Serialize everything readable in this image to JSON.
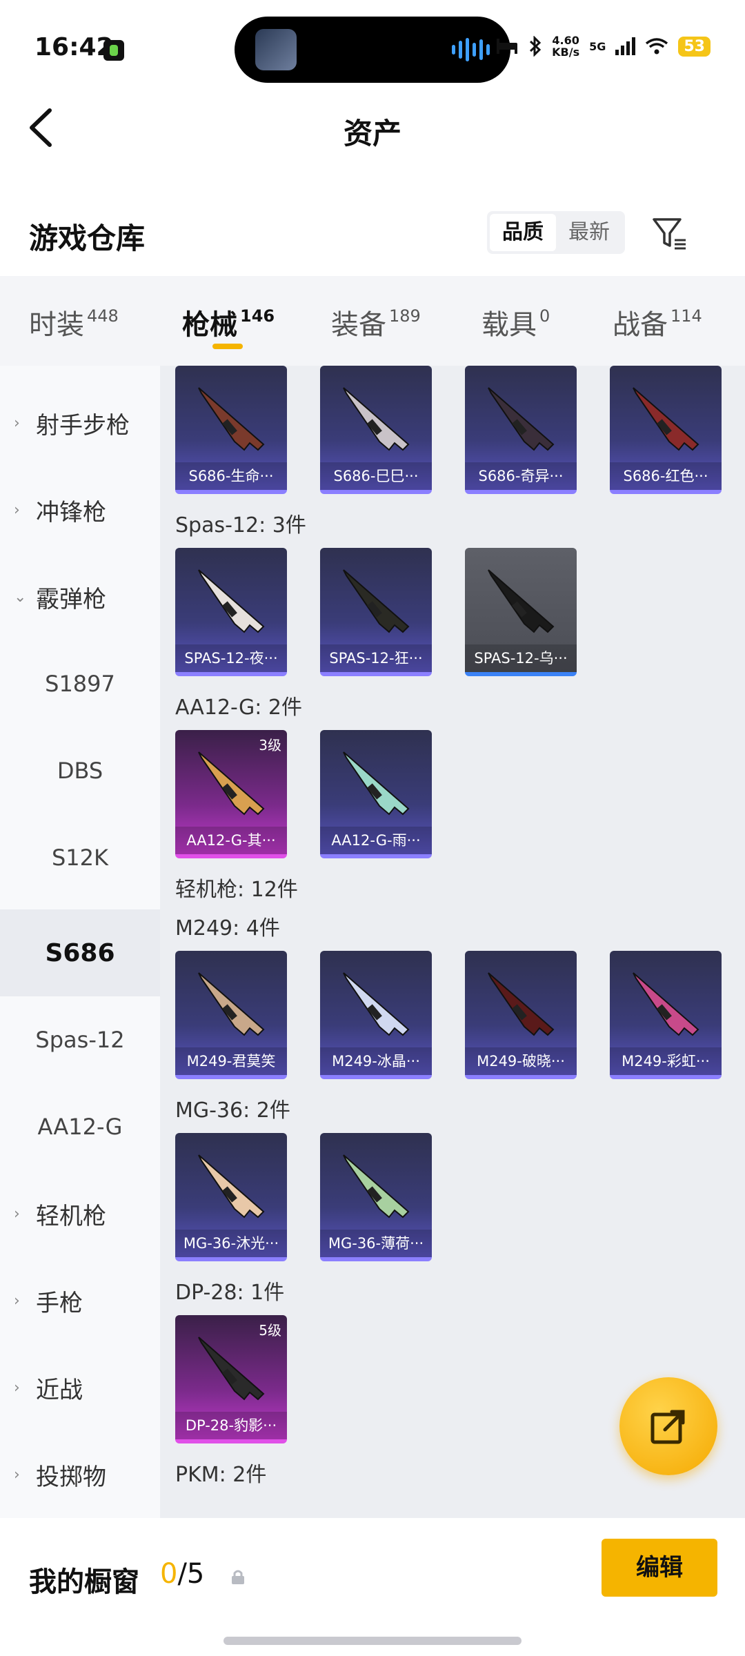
{
  "status_bar": {
    "time": "16:42",
    "net_speed_value": "4.60",
    "net_speed_unit": "KB/s",
    "network": "5G",
    "battery": "53"
  },
  "header": {
    "title": "资产",
    "back_icon": "chevron-left-icon"
  },
  "warehouse": {
    "title": "游戏仓库",
    "sort_options": [
      "品质",
      "最新"
    ],
    "sort_selected": "品质",
    "filter_icon": "filter-icon"
  },
  "tabs": [
    {
      "label": "时装",
      "count": "448"
    },
    {
      "label": "枪械",
      "count": "146",
      "active": true
    },
    {
      "label": "装备",
      "count": "189"
    },
    {
      "label": "载具",
      "count": "0"
    },
    {
      "label": "战备",
      "count": "114"
    }
  ],
  "sidebar": {
    "items": [
      {
        "label": "射手步枪",
        "type": "category",
        "expanded": false
      },
      {
        "label": "冲锋枪",
        "type": "category",
        "expanded": false
      },
      {
        "label": "霰弹枪",
        "type": "category",
        "expanded": true
      },
      {
        "label": "S1897",
        "type": "sub"
      },
      {
        "label": "DBS",
        "type": "sub"
      },
      {
        "label": "S12K",
        "type": "sub"
      },
      {
        "label": "S686",
        "type": "sub",
        "selected": true
      },
      {
        "label": "Spas-12",
        "type": "sub"
      },
      {
        "label": "AA12-G",
        "type": "sub"
      },
      {
        "label": "轻机枪",
        "type": "category",
        "expanded": false
      },
      {
        "label": "手枪",
        "type": "category",
        "expanded": false
      },
      {
        "label": "近战",
        "type": "category",
        "expanded": false
      },
      {
        "label": "投掷物",
        "type": "category",
        "expanded": false
      }
    ]
  },
  "groups": [
    {
      "label": "",
      "items": [
        {
          "name": "S686-生命···",
          "rarity": "purple"
        },
        {
          "name": "S686-巳巳···",
          "rarity": "purple"
        },
        {
          "name": "S686-奇异···",
          "rarity": "purple"
        },
        {
          "name": "S686-红色···",
          "rarity": "purple"
        }
      ]
    },
    {
      "label": "Spas-12: 3件",
      "items": [
        {
          "name": "SPAS-12-夜···",
          "rarity": "purple"
        },
        {
          "name": "SPAS-12-狂···",
          "rarity": "purple"
        },
        {
          "name": "SPAS-12-乌···",
          "rarity": "gray"
        }
      ]
    },
    {
      "label": "AA12-G: 2件",
      "items": [
        {
          "name": "AA12-G-其···",
          "rarity": "pink",
          "level": "3级"
        },
        {
          "name": "AA12-G-雨···",
          "rarity": "purple"
        }
      ]
    },
    {
      "label": "轻机枪: 12件",
      "items": []
    },
    {
      "label": "M249: 4件",
      "items": [
        {
          "name": "M249-君莫笑",
          "rarity": "purple"
        },
        {
          "name": "M249-冰晶···",
          "rarity": "purple"
        },
        {
          "name": "M249-破晓···",
          "rarity": "purple"
        },
        {
          "name": "M249-彩虹···",
          "rarity": "purple"
        }
      ]
    },
    {
      "label": "MG-36: 2件",
      "items": [
        {
          "name": "MG-36-沐光···",
          "rarity": "purple"
        },
        {
          "name": "MG-36-薄荷···",
          "rarity": "purple"
        }
      ]
    },
    {
      "label": "DP-28: 1件",
      "items": [
        {
          "name": "DP-28-豹影···",
          "rarity": "pink",
          "level": "5级"
        }
      ]
    },
    {
      "label": "PKM: 2件",
      "items": []
    }
  ],
  "fab": {
    "icon": "share-out-icon"
  },
  "bottom_bar": {
    "label": "我的橱窗",
    "current": "0",
    "total": "/5",
    "lock_icon": "lock-icon",
    "edit_label": "编辑"
  },
  "colors": {
    "accent": "#f5b400",
    "card_purple": "#3a3c78",
    "card_pink": "#7a2a8a",
    "card_gray": "#55575f"
  }
}
